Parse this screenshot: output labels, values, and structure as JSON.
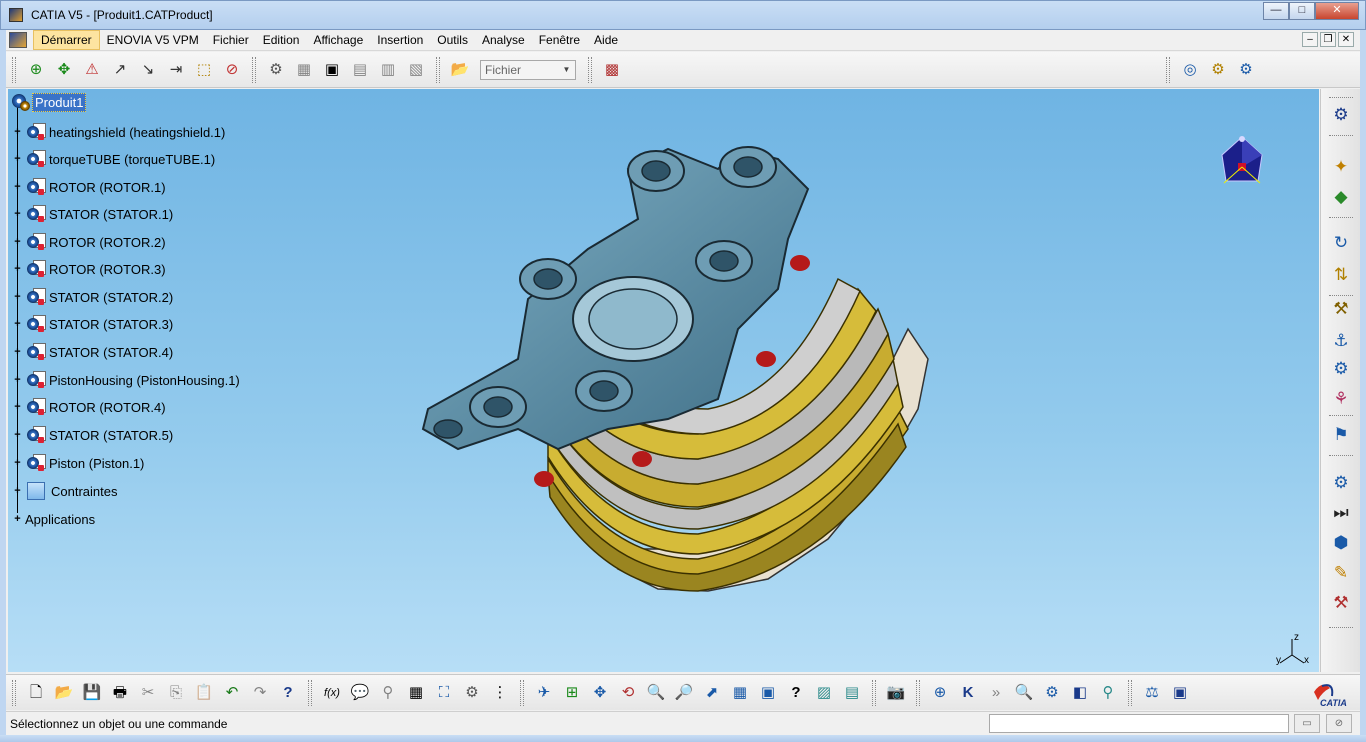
{
  "window": {
    "title": "CATIA V5 - [Produit1.CATProduct]",
    "controls": {
      "minimize": "—",
      "maximize": "□",
      "close": "✕"
    }
  },
  "menubar": {
    "items": [
      {
        "label": "Démarrer",
        "active": true
      },
      {
        "label": "ENOVIA V5 VPM"
      },
      {
        "label": "Fichier"
      },
      {
        "label": "Edition"
      },
      {
        "label": "Affichage"
      },
      {
        "label": "Insertion"
      },
      {
        "label": "Outils"
      },
      {
        "label": "Analyse"
      },
      {
        "label": "Fenêtre"
      },
      {
        "label": "Aide"
      }
    ],
    "mdi": {
      "minimize": "–",
      "restore": "❐",
      "close": "✕"
    }
  },
  "toptoolbar": {
    "group1": [
      "⊕",
      "✥",
      "⚠",
      "↗",
      "↘",
      "⇥",
      "⬚",
      "⊘"
    ],
    "group2": [
      "⚙",
      "▦",
      "▣",
      "▤",
      "▥",
      "▧"
    ],
    "open_icon": "📂",
    "fichier_combo": {
      "value": "Fichier",
      "arrow": "▼"
    },
    "group3": [
      "▩"
    ],
    "group4": [
      "◎",
      "⚙",
      "⚙"
    ]
  },
  "spec_tree": {
    "root": "Produit1",
    "items": [
      {
        "label": "heatingshield (heatingshield.1)",
        "type": "part"
      },
      {
        "label": "torqueTUBE (torqueTUBE.1)",
        "type": "part"
      },
      {
        "label": "ROTOR (ROTOR.1)",
        "type": "part"
      },
      {
        "label": "STATOR (STATOR.1)",
        "type": "part"
      },
      {
        "label": "ROTOR (ROTOR.2)",
        "type": "part"
      },
      {
        "label": "ROTOR (ROTOR.3)",
        "type": "part"
      },
      {
        "label": "STATOR (STATOR.2)",
        "type": "part"
      },
      {
        "label": "STATOR (STATOR.3)",
        "type": "part"
      },
      {
        "label": "STATOR (STATOR.4)",
        "type": "part"
      },
      {
        "label": "PistonHousing (PistonHousing.1)",
        "type": "part"
      },
      {
        "label": "ROTOR (ROTOR.4)",
        "type": "part"
      },
      {
        "label": "STATOR (STATOR.5)",
        "type": "part"
      },
      {
        "label": "Piston (Piston.1)",
        "type": "part"
      },
      {
        "label": "Contraintes",
        "type": "constraints"
      },
      {
        "label": "Applications",
        "type": "applications"
      }
    ],
    "expander": "+"
  },
  "axis": {
    "x": "x",
    "y": "y",
    "z": "z"
  },
  "righttoolbar": {
    "icons": [
      "⚙",
      "✦",
      "◆",
      "↻",
      "⇅",
      "⚒",
      "⚓",
      "⚙",
      "⚘",
      "⚑",
      "⚙",
      "⏭",
      "⬢",
      "✎",
      "⚒"
    ]
  },
  "bottomtoolbar": {
    "group1": [
      "🗋",
      "📂",
      "💾",
      "🖶",
      "✂",
      "⎘",
      "📋",
      "↶",
      "↷",
      "?"
    ],
    "group2": [
      "f(x)",
      "💬",
      "⚲",
      "▦",
      "⛶",
      "⚙",
      "⋮"
    ],
    "group3": [
      "✈",
      "⊞",
      "✥",
      "⟲",
      "🔍",
      "🔎",
      "⬈",
      "▦",
      "▣",
      "?",
      "▨",
      "▤"
    ],
    "group4": [
      "📷"
    ],
    "group5": [
      "⊕",
      "K",
      "»",
      "🔍",
      "⚙",
      "◧",
      "⚲"
    ],
    "group6": [
      "⚖",
      "▣"
    ],
    "logo_text": "CATIA"
  },
  "statusbar": {
    "message": "Sélectionnez un objet ou une commande",
    "btn1": "▭",
    "btn2": "⊘"
  }
}
